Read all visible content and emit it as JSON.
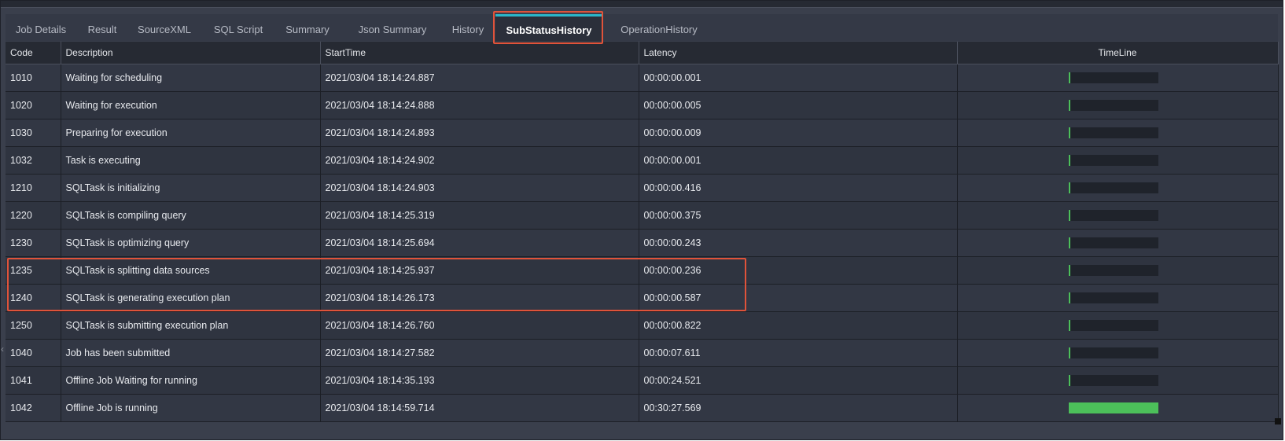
{
  "tabs": [
    {
      "label": "Job Details",
      "active": false
    },
    {
      "label": "Result",
      "active": false
    },
    {
      "label": "SourceXML",
      "active": false
    },
    {
      "label": "SQL Script",
      "active": false
    },
    {
      "label": "Summary",
      "active": false
    },
    {
      "label": "Json Summary",
      "active": false
    },
    {
      "label": "History",
      "active": false
    },
    {
      "label": "SubStatusHistory",
      "active": true
    },
    {
      "label": "OperationHistory",
      "active": false
    }
  ],
  "columns": {
    "code": "Code",
    "description": "Description",
    "start_time": "StartTime",
    "latency": "Latency",
    "timeline": "TimeLine"
  },
  "rows": [
    {
      "code": "1010",
      "description": "Waiting for scheduling",
      "start_time": "2021/03/04 18:14:24.887",
      "latency": "00:00:00.001",
      "timeline_fraction": 0.0
    },
    {
      "code": "1020",
      "description": "Waiting for execution",
      "start_time": "2021/03/04 18:14:24.888",
      "latency": "00:00:00.005",
      "timeline_fraction": 0.0
    },
    {
      "code": "1030",
      "description": "Preparing for execution",
      "start_time": "2021/03/04 18:14:24.893",
      "latency": "00:00:00.009",
      "timeline_fraction": 0.0
    },
    {
      "code": "1032",
      "description": "Task is executing",
      "start_time": "2021/03/04 18:14:24.902",
      "latency": "00:00:00.001",
      "timeline_fraction": 0.0
    },
    {
      "code": "1210",
      "description": "SQLTask is initializing",
      "start_time": "2021/03/04 18:14:24.903",
      "latency": "00:00:00.416",
      "timeline_fraction": 0.0
    },
    {
      "code": "1220",
      "description": "SQLTask is compiling query",
      "start_time": "2021/03/04 18:14:25.319",
      "latency": "00:00:00.375",
      "timeline_fraction": 0.0
    },
    {
      "code": "1230",
      "description": "SQLTask is optimizing query",
      "start_time": "2021/03/04 18:14:25.694",
      "latency": "00:00:00.243",
      "timeline_fraction": 0.0
    },
    {
      "code": "1235",
      "description": "SQLTask is splitting data sources",
      "start_time": "2021/03/04 18:14:25.937",
      "latency": "00:00:00.236",
      "timeline_fraction": 0.0
    },
    {
      "code": "1240",
      "description": "SQLTask is generating execution plan",
      "start_time": "2021/03/04 18:14:26.173",
      "latency": "00:00:00.587",
      "timeline_fraction": 0.0
    },
    {
      "code": "1250",
      "description": "SQLTask is submitting execution plan",
      "start_time": "2021/03/04 18:14:26.760",
      "latency": "00:00:00.822",
      "timeline_fraction": 0.0
    },
    {
      "code": "1040",
      "description": "Job has been submitted",
      "start_time": "2021/03/04 18:14:27.582",
      "latency": "00:00:07.611",
      "timeline_fraction": 0.0
    },
    {
      "code": "1041",
      "description": "Offline Job Waiting for running",
      "start_time": "2021/03/04 18:14:35.193",
      "latency": "00:00:24.521",
      "timeline_fraction": 0.0
    },
    {
      "code": "1042",
      "description": "Offline Job is running",
      "start_time": "2021/03/04 18:14:59.714",
      "latency": "00:30:27.569",
      "timeline_fraction": 1.0
    }
  ],
  "colors": {
    "accent": "#2bb7c9",
    "highlight": "#e0533a",
    "timeline_fill": "#4cc05a"
  }
}
